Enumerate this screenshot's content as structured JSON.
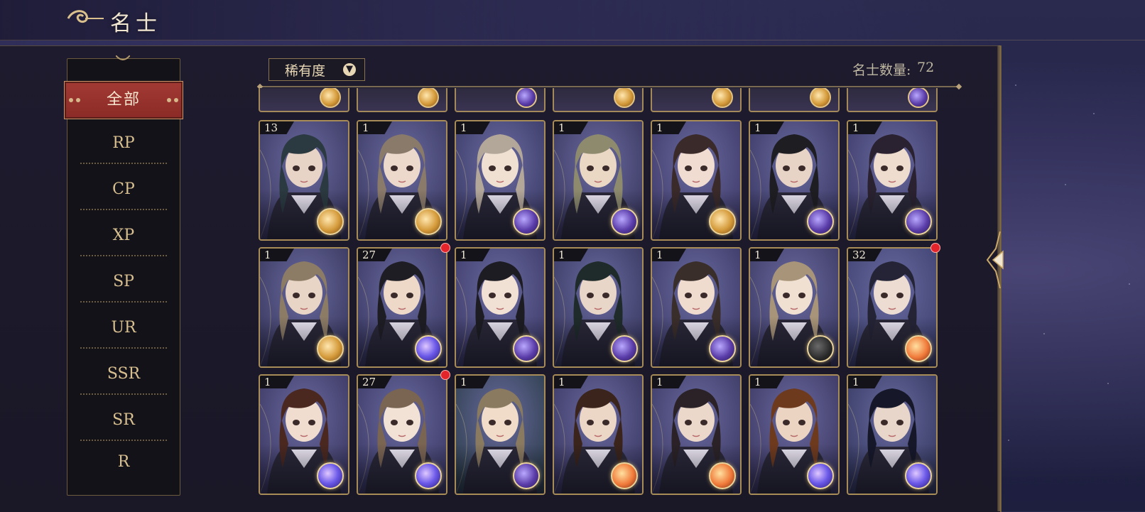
{
  "header": {
    "title": "名士"
  },
  "sidebar": {
    "active": "全部",
    "items": [
      "RP",
      "CP",
      "XP",
      "SP",
      "UR",
      "SSR",
      "SR",
      "R"
    ]
  },
  "toolbar": {
    "sort_label": "稀有度",
    "count_label": "名士数量:",
    "count_value": "72"
  },
  "colors": {
    "accent_gold": "#c9a86a",
    "active_red": "#9a332e",
    "notice_red": "#e3242b"
  },
  "cards": [
    {
      "level": "13",
      "orb": "gold",
      "notice": false,
      "hair": "#2b3a40",
      "skin": "#e7d4c6",
      "bg": "#3a3860"
    },
    {
      "level": "1",
      "orb": "gold",
      "notice": false,
      "hair": "#8a7a6a",
      "skin": "#ecd9cc",
      "bg": "#3b3a63"
    },
    {
      "level": "1",
      "orb": "purple",
      "notice": false,
      "hair": "#b3a79a",
      "skin": "#efe0d2",
      "bg": "#3a3a66"
    },
    {
      "level": "1",
      "orb": "purple",
      "notice": false,
      "hair": "#8d8a6e",
      "skin": "#ead7c4",
      "bg": "#39375e"
    },
    {
      "level": "1",
      "orb": "gold",
      "notice": false,
      "hair": "#3a2a2a",
      "skin": "#f0dcd0",
      "bg": "#3d3967"
    },
    {
      "level": "1",
      "orb": "purple",
      "notice": false,
      "hair": "#1e1e22",
      "skin": "#e8d4c6",
      "bg": "#383661"
    },
    {
      "level": "1",
      "orb": "purple",
      "notice": false,
      "hair": "#2a2230",
      "skin": "#eedcce",
      "bg": "#3a3866"
    },
    {
      "level": "1",
      "orb": "gold",
      "notice": false,
      "hair": "#8c7c66",
      "skin": "#e9d5c5",
      "bg": "#37365c"
    },
    {
      "level": "27",
      "orb": "blue",
      "notice": true,
      "hair": "#1f1d24",
      "skin": "#eed9c8",
      "bg": "#383761"
    },
    {
      "level": "1",
      "orb": "purple",
      "notice": false,
      "hair": "#1c1c22",
      "skin": "#f1e0d4",
      "bg": "#3c3a68"
    },
    {
      "level": "1",
      "orb": "purple",
      "notice": false,
      "hair": "#1f2b2a",
      "skin": "#e8d6c8",
      "bg": "#37375f"
    },
    {
      "level": "1",
      "orb": "purple",
      "notice": false,
      "hair": "#3a2e2a",
      "skin": "#efdccf",
      "bg": "#3b3965"
    },
    {
      "level": "1",
      "orb": "dark",
      "notice": false,
      "hair": "#a89478",
      "skin": "#f0e0d2",
      "bg": "#3b3962"
    },
    {
      "level": "32",
      "orb": "orange",
      "notice": true,
      "hair": "#242436",
      "skin": "#ecdcd2",
      "bg": "#3d4170"
    },
    {
      "level": "1",
      "orb": "blue",
      "notice": false,
      "hair": "#4a2820",
      "skin": "#f1ddd0",
      "bg": "#3a3660"
    },
    {
      "level": "27",
      "orb": "blue",
      "notice": true,
      "hair": "#7a6452",
      "skin": "#f2e2d6",
      "bg": "#3a3864"
    },
    {
      "level": "1",
      "orb": "purple",
      "notice": false,
      "hair": "#8a7a60",
      "skin": "#f0dcc8",
      "bg": "#2c3e4a"
    },
    {
      "level": "1",
      "orb": "orange",
      "notice": false,
      "hair": "#3a241c",
      "skin": "#ecd6c6",
      "bg": "#393660"
    },
    {
      "level": "1",
      "orb": "orange",
      "notice": false,
      "hair": "#2a2226",
      "skin": "#ecd8ca",
      "bg": "#3b3862"
    },
    {
      "level": "1",
      "orb": "blue",
      "notice": false,
      "hair": "#6e3a1e",
      "skin": "#ebd4c2",
      "bg": "#3b3660"
    },
    {
      "level": "1",
      "orb": "blue",
      "notice": false,
      "hair": "#16182a",
      "skin": "#e8d6ca",
      "bg": "#33385f"
    }
  ],
  "partial_row": [
    "gold",
    "gold",
    "purple",
    "gold",
    "gold",
    "gold",
    "purple"
  ]
}
